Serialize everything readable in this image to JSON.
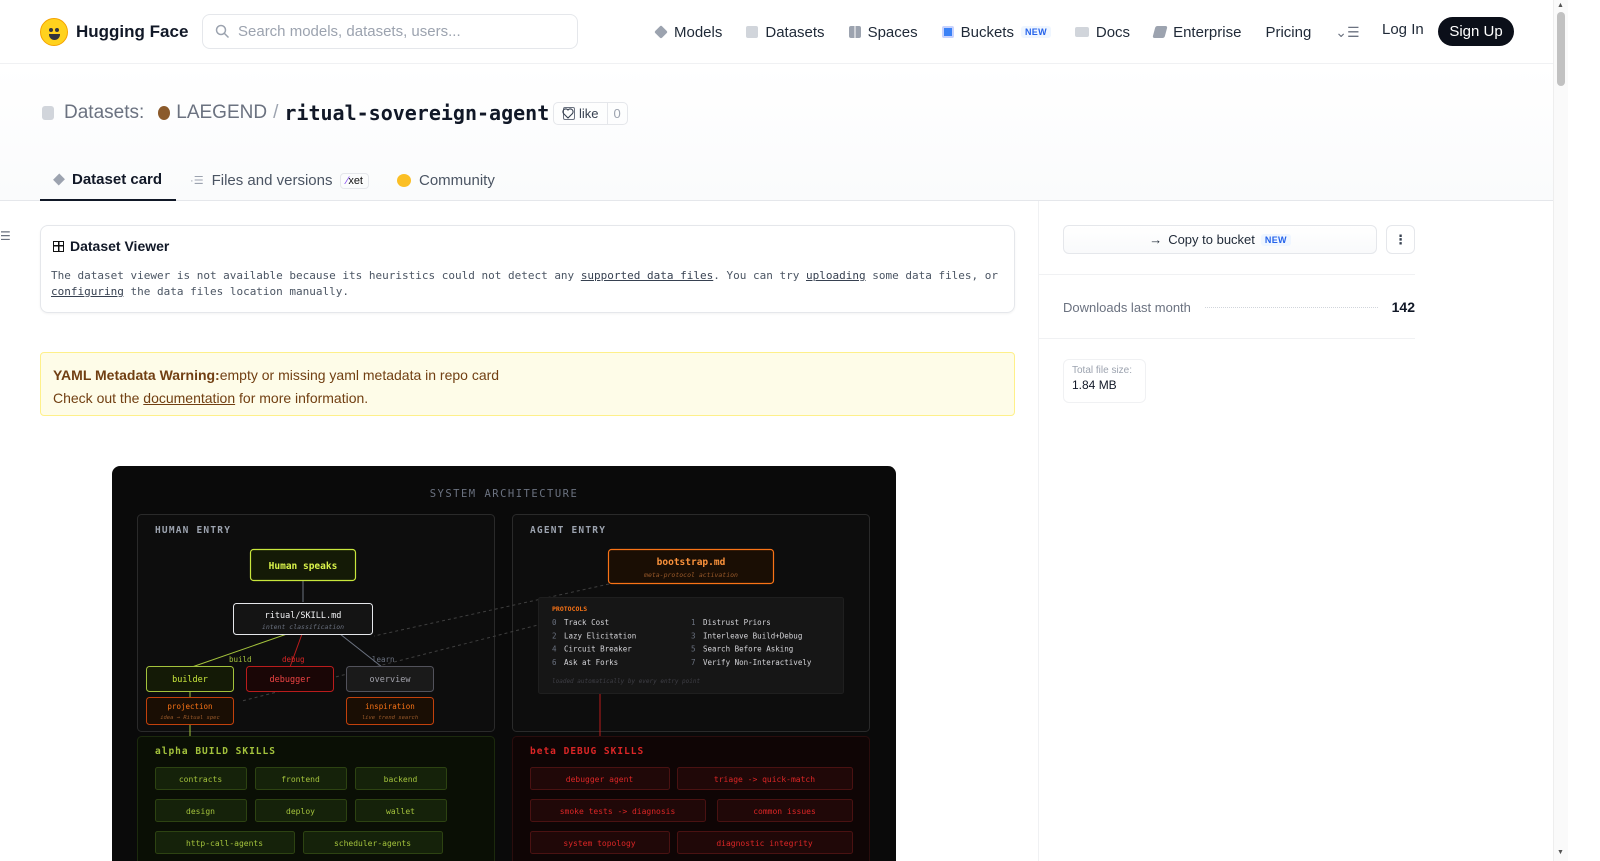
{
  "header": {
    "brand": "Hugging Face",
    "search_placeholder": "Search models, datasets, users...",
    "nav": {
      "models": "Models",
      "datasets": "Datasets",
      "spaces": "Spaces",
      "buckets": "Buckets",
      "buckets_badge": "NEW",
      "docs": "Docs",
      "enterprise": "Enterprise",
      "pricing": "Pricing"
    },
    "login": "Log In",
    "signup": "Sign Up"
  },
  "repo": {
    "type_label": "Datasets:",
    "owner": "LAEGEND",
    "separator": "/",
    "name": "ritual-sovereign-agent",
    "like_label": "like",
    "like_count": "0"
  },
  "tabs": {
    "card": "Dataset card",
    "files": "Files and versions",
    "files_badge": "xet",
    "community": "Community"
  },
  "viewer": {
    "title": "Dataset Viewer",
    "text_1": "The dataset viewer is not available because its heuristics could not detect any ",
    "link_1": "supported data files",
    "text_2": ". You can try ",
    "link_2": "uploading",
    "text_3": " some data files, or ",
    "link_3": "configuring",
    "text_4": " the data files location manually."
  },
  "warning": {
    "title": "YAML Metadata Warning:",
    "message": "empty or missing yaml metadata in repo card",
    "line2_pre": "Check out the ",
    "link": "documentation",
    "line2_post": " for more information."
  },
  "diagram": {
    "title": "SYSTEM ARCHITECTURE",
    "human_entry": "HUMAN ENTRY",
    "agent_entry": "AGENT ENTRY",
    "human_speaks": "Human speaks",
    "skill": "ritual/SKILL.md",
    "skill_sub": "intent classification",
    "edge_build": "build",
    "edge_debug": "debug",
    "edge_learn": "learn",
    "builder": "builder",
    "debugger": "debugger",
    "overview": "overview",
    "projection": "projection",
    "projection_sub": "idea → Ritual spec",
    "inspiration": "inspiration",
    "inspiration_sub": "live trend search",
    "bootstrap": "bootstrap.md",
    "bootstrap_sub": "meta-protocol activation",
    "protocols_title": "PROTOCOLS",
    "protocols": [
      {
        "n": "0",
        "label": "Track Cost"
      },
      {
        "n": "1",
        "label": "Distrust Priors"
      },
      {
        "n": "2",
        "label": "Lazy Elicitation"
      },
      {
        "n": "3",
        "label": "Interleave Build+Debug"
      },
      {
        "n": "4",
        "label": "Circuit Breaker"
      },
      {
        "n": "5",
        "label": "Search Before Asking"
      },
      {
        "n": "6",
        "label": "Ask at Forks"
      },
      {
        "n": "7",
        "label": "Verify Non-Interactively"
      }
    ],
    "protocols_note": "loaded automatically by every entry point",
    "build_title": "alpha BUILD SKILLS",
    "build_skills": [
      "contracts",
      "frontend",
      "backend",
      "design",
      "deploy",
      "wallet",
      "http-call-agents",
      "scheduler-agents"
    ],
    "debug_title": "beta DEBUG SKILLS",
    "debug_skills": [
      "debugger agent",
      "triage -> quick-match",
      "smoke tests -> diagnosis",
      "common issues",
      "system topology",
      "diagnostic integrity"
    ]
  },
  "sidebar": {
    "copy_bucket": "Copy to bucket",
    "copy_bucket_badge": "NEW",
    "downloads_label": "Downloads last month",
    "downloads_value": "142",
    "filesize_label": "Total file size:",
    "filesize_value": "1.84 MB"
  },
  "colors": {
    "accent_dark": "#0b0f19",
    "warning_bg": "#fefce8",
    "diagram_bg": "#0a0a0a",
    "diagram_green": "#c8e63c",
    "diagram_orange": "#f97316",
    "diagram_red": "#dc2626"
  }
}
